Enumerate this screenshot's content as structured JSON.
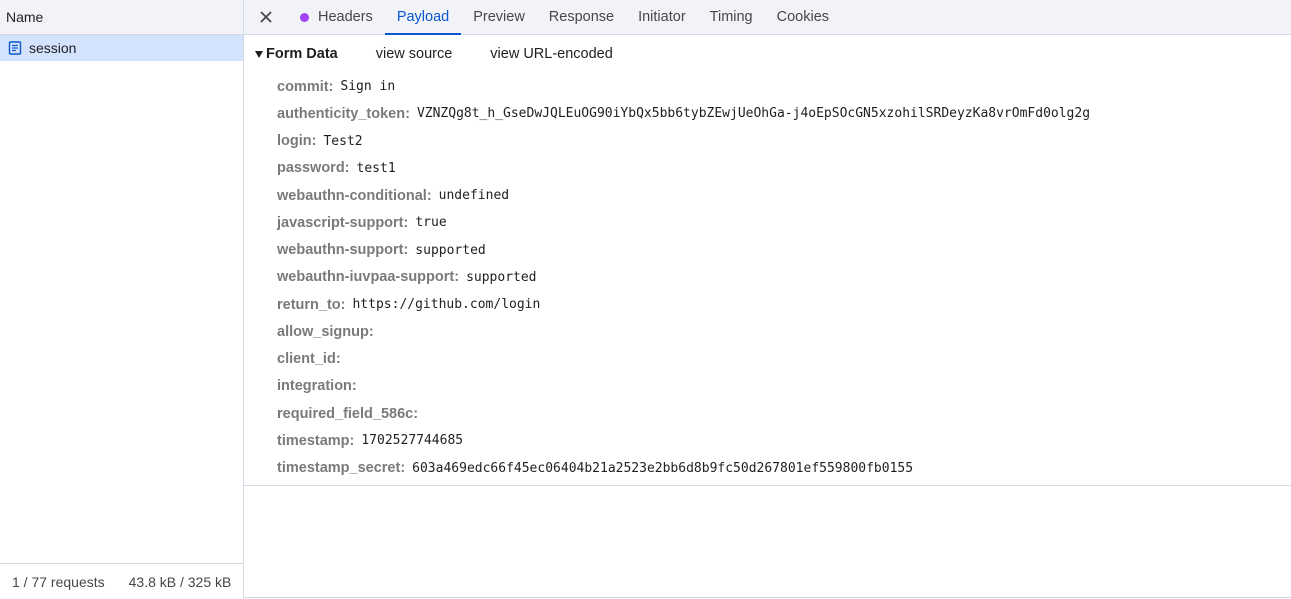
{
  "requests_pane": {
    "column_header": "Name",
    "items": [
      {
        "name": "session",
        "icon": "document-icon",
        "selected": true
      }
    ],
    "footer": {
      "requests": "1 / 77 requests",
      "transferred": "43.8 kB / 325 kB"
    }
  },
  "detail_tabs": [
    {
      "label": "Headers",
      "has_dot": true,
      "active": false
    },
    {
      "label": "Payload",
      "has_dot": false,
      "active": true
    },
    {
      "label": "Preview",
      "has_dot": false,
      "active": false
    },
    {
      "label": "Response",
      "has_dot": false,
      "active": false
    },
    {
      "label": "Initiator",
      "has_dot": false,
      "active": false
    },
    {
      "label": "Timing",
      "has_dot": false,
      "active": false
    },
    {
      "label": "Cookies",
      "has_dot": false,
      "active": false
    }
  ],
  "form_data": {
    "title": "Form Data",
    "view_source": "view source",
    "view_url_encoded": "view URL-encoded",
    "fields": [
      {
        "key": "commit:",
        "value": "Sign in"
      },
      {
        "key": "authenticity_token:",
        "value": "VZNZQg8t_h_GseDwJQLEuOG90iYbQx5bb6tybZEwjUeOhGa-j4oEpSOcGN5xzohilSRDeyzKa8vrOmFd0olg2g"
      },
      {
        "key": "login:",
        "value": "Test2"
      },
      {
        "key": "password:",
        "value": "test1"
      },
      {
        "key": "webauthn-conditional:",
        "value": "undefined"
      },
      {
        "key": "javascript-support:",
        "value": "true"
      },
      {
        "key": "webauthn-support:",
        "value": "supported"
      },
      {
        "key": "webauthn-iuvpaa-support:",
        "value": "supported"
      },
      {
        "key": "return_to:",
        "value": "https://github.com/login"
      },
      {
        "key": "allow_signup:",
        "value": ""
      },
      {
        "key": "client_id:",
        "value": ""
      },
      {
        "key": "integration:",
        "value": ""
      },
      {
        "key": "required_field_586c:",
        "value": ""
      },
      {
        "key": "timestamp:",
        "value": "1702527744685"
      },
      {
        "key": "timestamp_secret:",
        "value": "603a469edc66f45ec06404b21a2523e2bb6d8b9fc50d267801ef559800fb0155"
      }
    ]
  },
  "colors": {
    "accent": "#0b57d0",
    "selected_row": "#d3e3fd",
    "headers_dot": "#a142f4",
    "key_text": "#7a7a7a"
  }
}
